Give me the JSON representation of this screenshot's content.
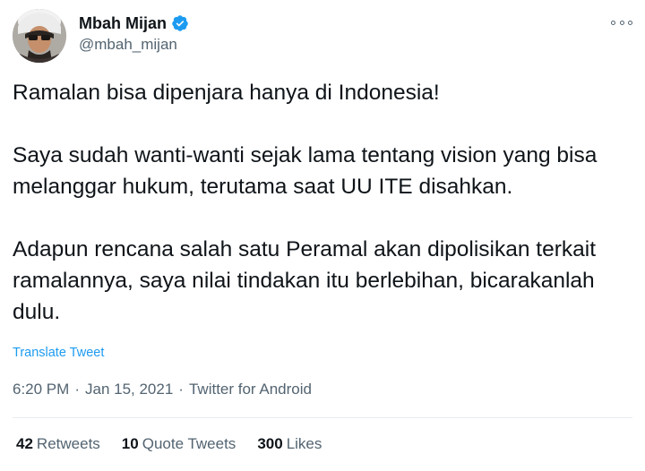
{
  "author": {
    "display_name": "Mbah Mijan",
    "handle": "@mbah_mijan",
    "verified": true,
    "avatar_icon": "avatar-photo"
  },
  "tweet": {
    "paragraphs": [
      "Ramalan bisa dipenjara hanya di Indonesia!",
      "Saya sudah wanti-wanti sejak lama tentang vision yang bisa melanggar hukum, terutama saat UU ITE disahkan.",
      "Adapun rencana salah satu Peramal akan dipolisikan terkait ramalannya, saya nilai tindakan itu berlebihan, bicarakanlah dulu."
    ],
    "translate_label": "Translate Tweet",
    "time": "6:20 PM",
    "date": "Jan 15, 2021",
    "source": "Twitter for Android",
    "separator": "·"
  },
  "stats": {
    "retweets_count": "42",
    "retweets_label": "Retweets",
    "quotes_count": "10",
    "quotes_label": "Quote Tweets",
    "likes_count": "300",
    "likes_label": "Likes"
  },
  "colors": {
    "accent": "#1d9bf0",
    "text": "#0f1419",
    "secondary": "#536471",
    "divider": "#e6ecf0"
  }
}
